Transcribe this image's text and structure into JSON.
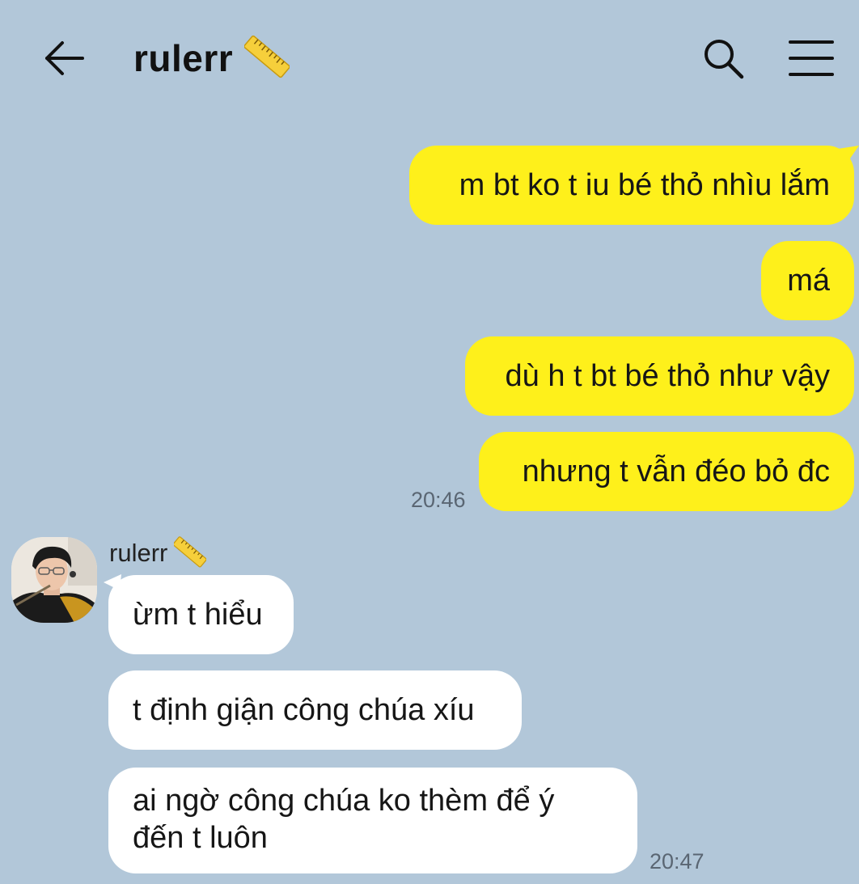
{
  "header": {
    "title": "rulerr",
    "title_emoji": "ruler-icon",
    "back_icon": "arrow-left-icon",
    "search_icon": "search-icon",
    "menu_icon": "menu-icon"
  },
  "colors": {
    "background": "#b2c7d9",
    "outgoing_bubble": "#fef01b",
    "incoming_bubble": "#ffffff",
    "timestamp": "#5a6673"
  },
  "messages_out": [
    {
      "text": "m bt ko t iu bé thỏ nhìu lắm"
    },
    {
      "text": "má"
    },
    {
      "text": "dù h t bt bé thỏ như vậy"
    },
    {
      "text": "nhưng t vẫn đéo bỏ đc"
    }
  ],
  "messages_out_time": "20:46",
  "incoming": {
    "sender": "rulerr",
    "sender_emoji": "ruler-icon",
    "avatar": "avatar",
    "messages": [
      {
        "text": "ừm t hiểu"
      },
      {
        "text": "t định giận công chúa xíu"
      },
      {
        "text": "ai ngờ công chúa ko thèm để ý đến t luôn"
      }
    ],
    "time": "20:47"
  }
}
